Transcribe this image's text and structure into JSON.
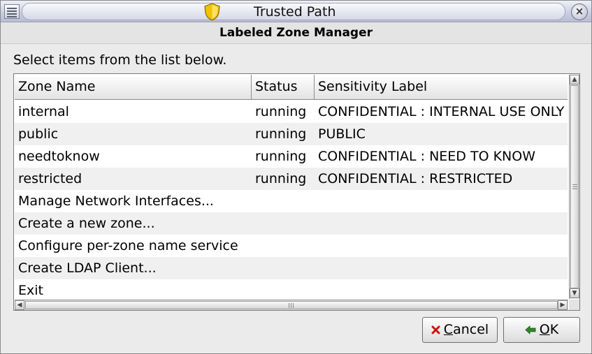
{
  "window": {
    "title": "Trusted Path",
    "close_glyph": "×"
  },
  "dialog": {
    "header": "Labeled Zone Manager",
    "instruction": "Select items from the list below."
  },
  "table": {
    "columns": [
      "Zone Name",
      "Status",
      "Sensitivity Label"
    ],
    "rows": [
      {
        "name": "internal",
        "status": "running",
        "label": "CONFIDENTIAL : INTERNAL USE ONLY"
      },
      {
        "name": "public",
        "status": "running",
        "label": "PUBLIC"
      },
      {
        "name": "needtoknow",
        "status": "running",
        "label": "CONFIDENTIAL : NEED TO KNOW"
      },
      {
        "name": "restricted",
        "status": "running",
        "label": "CONFIDENTIAL : RESTRICTED"
      },
      {
        "name": "Manage Network Interfaces...",
        "status": "",
        "label": ""
      },
      {
        "name": "Create a new zone...",
        "status": "",
        "label": ""
      },
      {
        "name": "Configure per-zone name service",
        "status": "",
        "label": ""
      },
      {
        "name": "Create LDAP Client...",
        "status": "",
        "label": ""
      },
      {
        "name": "Exit",
        "status": "",
        "label": ""
      }
    ]
  },
  "buttons": {
    "cancel_first": "C",
    "cancel_rest": "ancel",
    "ok_first": "O",
    "ok_rest": "K"
  },
  "icons": {
    "window_menu": "window-menu-icon",
    "shield": "shield-icon",
    "close": "close-icon",
    "cancel": "red-x-icon",
    "ok": "green-arrow-icon"
  },
  "colors": {
    "shield_fill": "#f2c200",
    "cancel_icon": "#cc1111",
    "ok_icon": "#2a8a2a"
  }
}
